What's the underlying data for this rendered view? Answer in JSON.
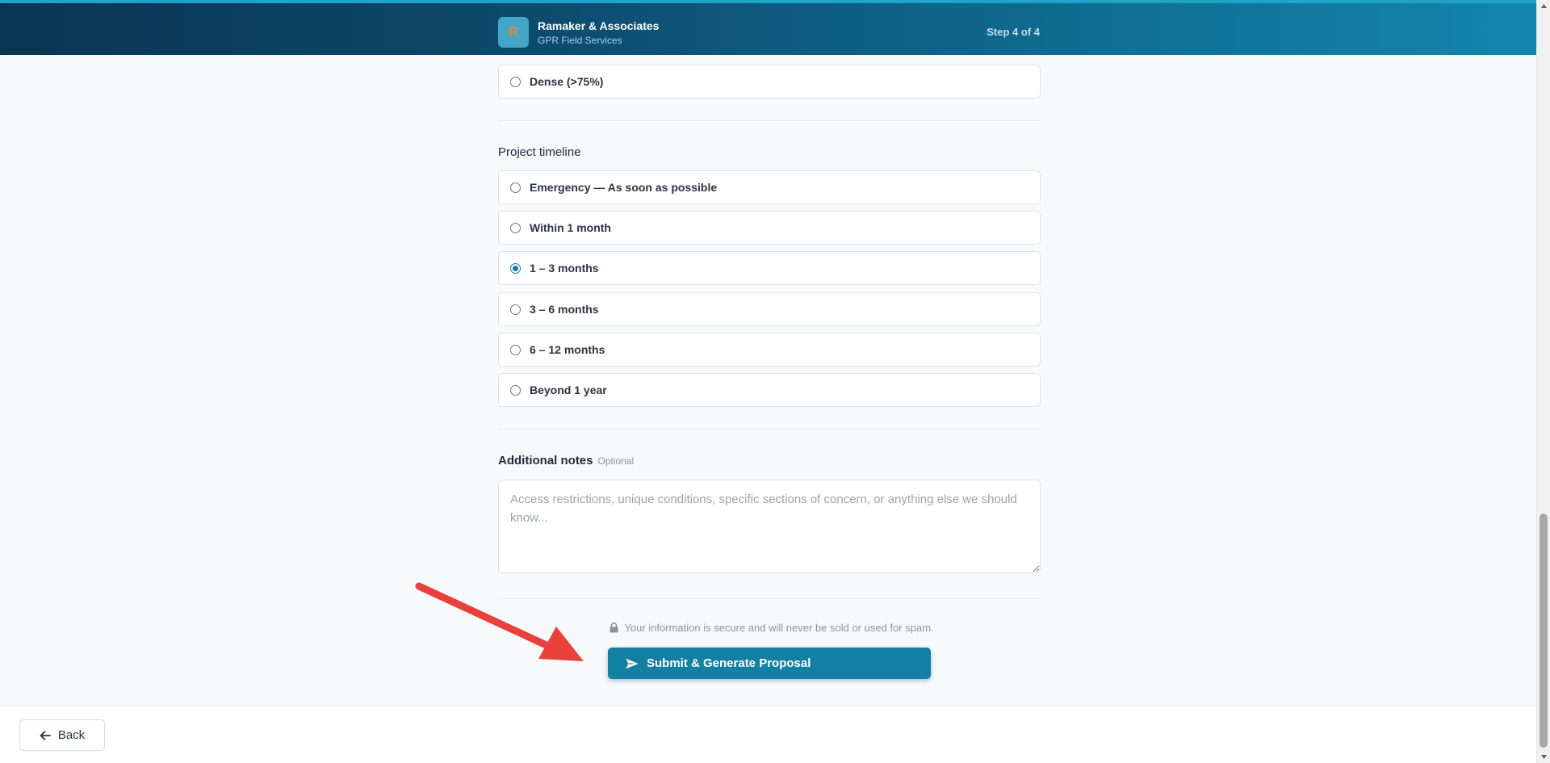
{
  "header": {
    "logo_letter": "R",
    "company_name": "Ramaker & Associates",
    "company_subtitle": "GPR Field Services",
    "step_indicator": "Step 4 of 4"
  },
  "density": {
    "options": [
      {
        "label": "Dense (>75%)",
        "selected": false
      }
    ]
  },
  "timeline": {
    "label": "Project timeline",
    "options": [
      {
        "label": "Emergency — As soon as possible",
        "selected": false
      },
      {
        "label": "Within 1 month",
        "selected": false
      },
      {
        "label": "1 – 3 months",
        "selected": true
      },
      {
        "label": "3 – 6 months",
        "selected": false
      },
      {
        "label": "6 – 12 months",
        "selected": false
      },
      {
        "label": "Beyond 1 year",
        "selected": false
      }
    ]
  },
  "notes": {
    "label": "Additional notes",
    "optional_tag": "Optional",
    "value": "",
    "placeholder": "Access restrictions, unique conditions, specific sections of concern, or anything else we should know..."
  },
  "secure_message": "Your information is secure and will never be sold or used for spam.",
  "submit_label": "Submit & Generate Proposal",
  "footer": {
    "back_label": "Back"
  },
  "colors": {
    "accent": "#137fa2",
    "header_dark": "#0a3552",
    "annotation": "#e8413c"
  },
  "icons": {
    "secure": "lock-icon",
    "submit": "send-icon",
    "back": "arrow-left-icon"
  }
}
